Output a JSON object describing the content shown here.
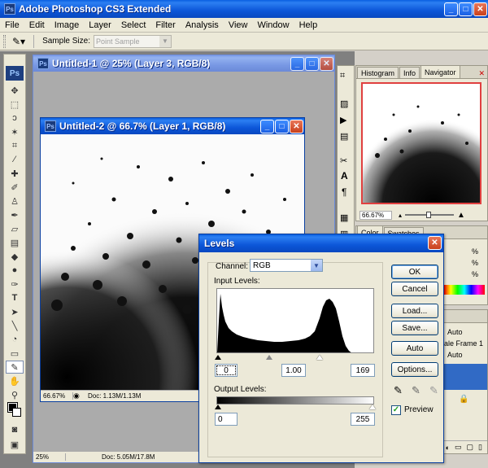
{
  "app": {
    "title": "Adobe Photoshop CS3 Extended",
    "menu": [
      "File",
      "Edit",
      "Image",
      "Layer",
      "Select",
      "Filter",
      "Analysis",
      "View",
      "Window",
      "Help"
    ]
  },
  "options_bar": {
    "sample_size_label": "Sample Size:",
    "sample_size_value": "Point Sample"
  },
  "toolbox": {
    "logo": "Ps"
  },
  "doc1": {
    "title": "Untitled-1 @ 25% (Layer 3, RGB/8)",
    "zoom": "25%",
    "doc_info": "Doc: 5.05M/17.8M"
  },
  "doc2": {
    "title": "Untitled-2 @ 66.7% (Layer 1, RGB/8)",
    "zoom": "66.67%",
    "doc_info": "Doc: 1.13M/1.13M"
  },
  "panels": {
    "nav_tabs": [
      "Histogram",
      "Info",
      "Navigator"
    ],
    "nav_zoom": "66.67%",
    "color_tabs": [
      "Color",
      "Swatches"
    ],
    "percent": [
      "%",
      "%",
      "%"
    ],
    "layer_frag": [
      "Auto",
      "ale Frame 1",
      "Auto"
    ]
  },
  "levels": {
    "title": "Levels",
    "channel_label": "Channel:",
    "channel_value": "RGB",
    "input_label": "Input Levels:",
    "input_black": "0",
    "input_gamma": "1.00",
    "input_white": "169",
    "output_label": "Output Levels:",
    "output_black": "0",
    "output_white": "255",
    "buttons": {
      "ok": "OK",
      "cancel": "Cancel",
      "load": "Load...",
      "save": "Save...",
      "auto": "Auto",
      "options": "Options..."
    },
    "preview_label": "Preview",
    "preview_checked": true
  }
}
